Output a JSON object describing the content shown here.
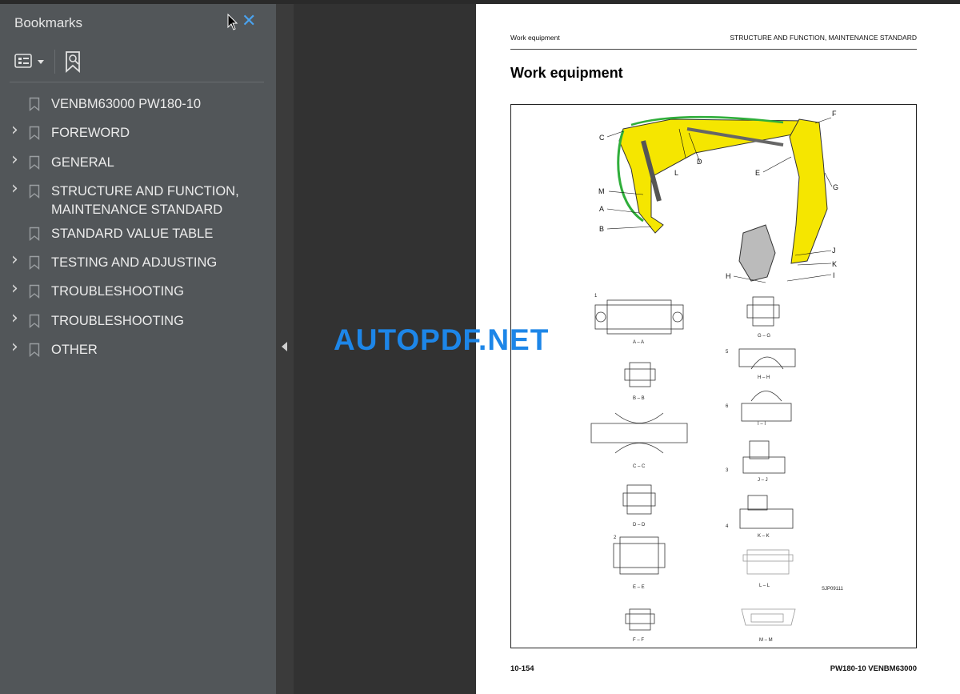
{
  "sidebar": {
    "title": "Bookmarks",
    "close_icon": "close-icon",
    "options_icon": "bookmark-options-icon",
    "find_icon": "find-bookmark-icon",
    "items": [
      {
        "label": "VENBM63000 PW180-10",
        "expandable": false
      },
      {
        "label": "FOREWORD",
        "expandable": true
      },
      {
        "label": "GENERAL",
        "expandable": true
      },
      {
        "label": "STRUCTURE AND FUNCTION,",
        "label2": "MAINTENANCE STANDARD",
        "expandable": true
      },
      {
        "label": "STANDARD VALUE TABLE",
        "expandable": false
      },
      {
        "label": "TESTING AND ADJUSTING",
        "expandable": true
      },
      {
        "label": "TROUBLESHOOTING",
        "expandable": true
      },
      {
        "label": "TROUBLESHOOTING",
        "expandable": true
      },
      {
        "label": "OTHER",
        "expandable": true
      }
    ]
  },
  "page": {
    "header_left": "Work equipment",
    "header_right": "STRUCTURE AND FUNCTION, MAINTENANCE STANDARD",
    "title": "Work equipment",
    "footer_left": "10-154",
    "footer_right": "PW180-10   VENBM63000",
    "figure_code": "SJP09111",
    "callouts": [
      "A",
      "B",
      "C",
      "D",
      "E",
      "F",
      "G",
      "H",
      "I",
      "J",
      "K",
      "L",
      "M"
    ],
    "sections": [
      "A – A",
      "B – B",
      "C – C",
      "D – D",
      "E – E",
      "F – F",
      "G – G",
      "H – H",
      "I – I",
      "J – J",
      "K – K",
      "L – L",
      "M – M"
    ],
    "part_numbers": [
      "1",
      "2",
      "3",
      "4",
      "5",
      "6"
    ]
  },
  "watermark": "AUTOPDF.NET",
  "colors": {
    "accent": "#4aa3f0",
    "watermark": "#1d86e8",
    "boom": "#f5e600"
  }
}
